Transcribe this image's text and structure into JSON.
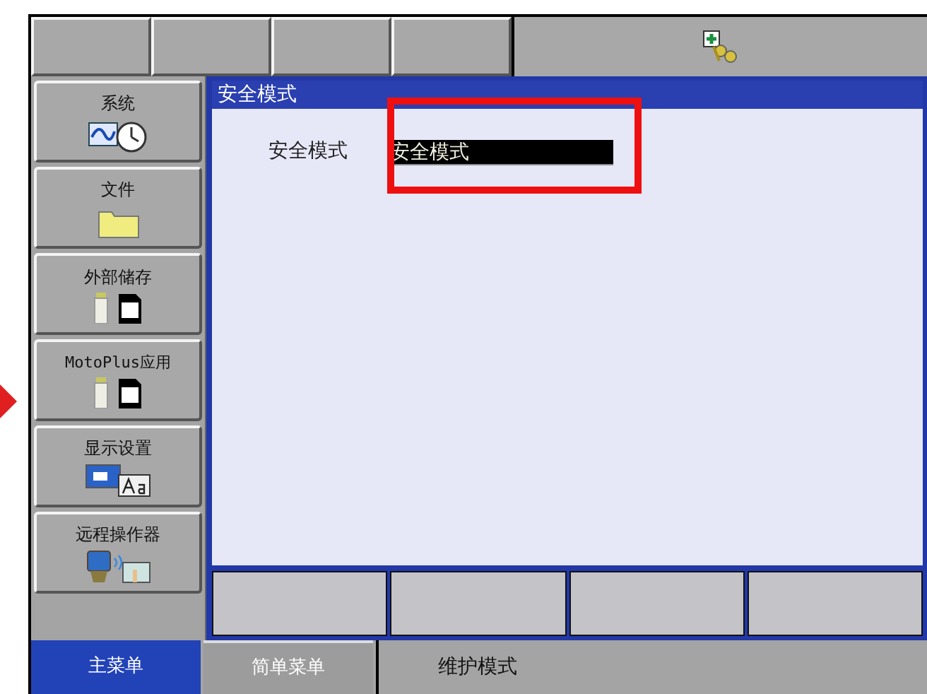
{
  "main_menu": [
    {
      "label": "系统"
    },
    {
      "label": "文件"
    },
    {
      "label": "外部储存"
    },
    {
      "label": "MotoPlus应用"
    },
    {
      "label": "显示设置"
    },
    {
      "label": "远程操作器"
    }
  ],
  "panel": {
    "title": "安全模式",
    "field_label": "安全模式",
    "field_value": "安全模式"
  },
  "bottom_tabs": [
    {
      "label": "主菜单",
      "selected": true
    },
    {
      "label": "简单菜单",
      "selected": false
    }
  ],
  "status": "维护模式"
}
